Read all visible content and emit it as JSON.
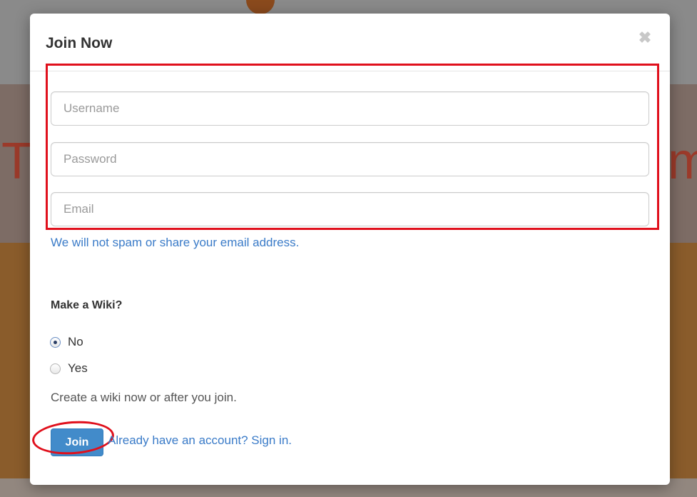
{
  "background": {
    "heading_left": "T",
    "heading_right": "m"
  },
  "modal": {
    "title": "Join Now",
    "close_glyph": "✖",
    "fields": {
      "username": {
        "value": "",
        "placeholder": "Username"
      },
      "password": {
        "value": "",
        "placeholder": "Password"
      },
      "email": {
        "value": "",
        "placeholder": "Email"
      }
    },
    "spam_note": "We will not spam or share your email address.",
    "wiki": {
      "label": "Make a Wiki?",
      "options": [
        {
          "label": "No",
          "selected": true
        },
        {
          "label": "Yes",
          "selected": false
        }
      ],
      "hint": "Create a wiki now or after you join."
    },
    "join_button": "Join",
    "signin_link": "Already have an account? Sign in."
  },
  "colors": {
    "primary": "#428bca",
    "link": "#3a7bc8",
    "highlight": "#e0101c"
  }
}
